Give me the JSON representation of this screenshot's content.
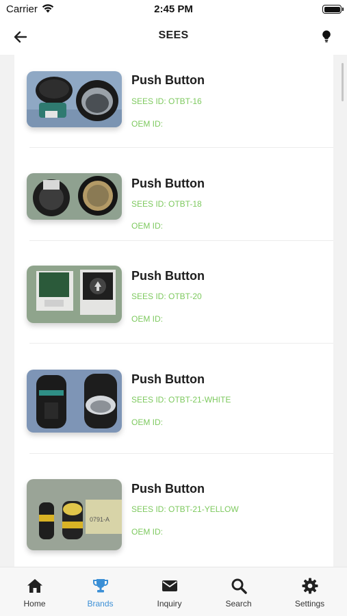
{
  "status_bar": {
    "carrier": "Carrier",
    "time": "2:45 PM"
  },
  "header": {
    "title": "SEES",
    "back_icon": "arrow-left-icon",
    "action_icon": "lightbulb-icon"
  },
  "products": [
    {
      "title": "Push Button",
      "sees_id": "SEES ID: OTBT-16",
      "oem_id": "OEM ID:"
    },
    {
      "title": "Push Button",
      "sees_id": "SEES ID: OTBT-18",
      "oem_id": "OEM ID:"
    },
    {
      "title": "Push Button",
      "sees_id": "SEES ID: OTBT-20",
      "oem_id": "OEM ID:"
    },
    {
      "title": "Push Button",
      "sees_id": "SEES ID: OTBT-21-WHITE",
      "oem_id": "OEM ID:"
    },
    {
      "title": "Push Button",
      "sees_id": "SEES ID: OTBT-21-YELLOW",
      "oem_id": "OEM ID:"
    }
  ],
  "tabs": [
    {
      "label": "Home",
      "icon": "home-icon",
      "active": false
    },
    {
      "label": "Brands",
      "icon": "trophy-icon",
      "active": true
    },
    {
      "label": "Inquiry",
      "icon": "envelope-icon",
      "active": false
    },
    {
      "label": "Search",
      "icon": "search-icon",
      "active": false
    },
    {
      "label": "Settings",
      "icon": "gear-icon",
      "active": false
    }
  ],
  "colors": {
    "accent": "#3b8fd6",
    "id_text": "#7dc95e",
    "title_text": "#1d1d1d",
    "background": "#f2f2f2"
  }
}
